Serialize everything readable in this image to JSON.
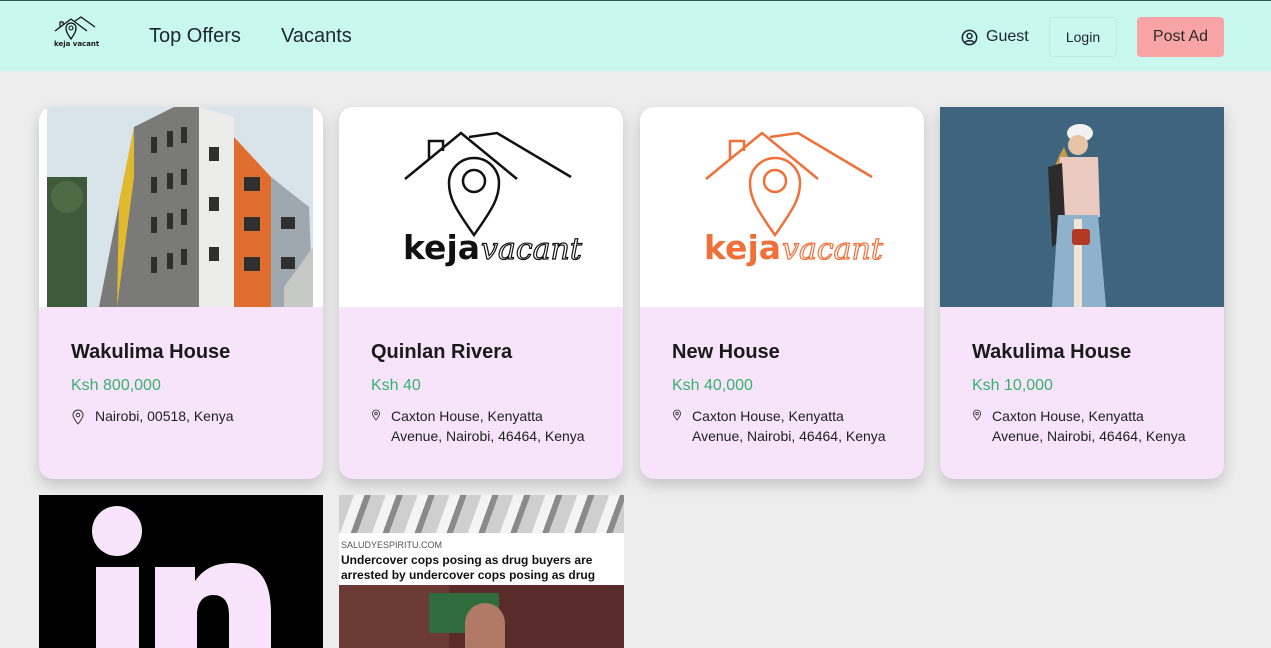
{
  "nav": {
    "logo_text": "keja vacant",
    "links": [
      "Top Offers",
      "Vacants"
    ],
    "guest_label": "Guest",
    "login_label": "Login",
    "post_ad_label": "Post Ad"
  },
  "listings": [
    {
      "title": "Wakulima House",
      "price": "Ksh 800,000",
      "location": "Nairobi, 00518, Kenya",
      "image": "building-photo"
    },
    {
      "title": "Quinlan Rivera",
      "price": "Ksh 40",
      "location": "Caxton House, Kenyatta Avenue, Nairobi, 46464, Kenya",
      "image": "keja-vacant-logo-black"
    },
    {
      "title": "New House",
      "price": "Ksh 40,000",
      "location": "Caxton House, Kenyatta Avenue, Nairobi, 46464, Kenya",
      "image": "keja-vacant-logo-orange"
    },
    {
      "title": "Wakulima House",
      "price": "Ksh 10,000",
      "location": "Caxton House, Kenyatta Avenue, Nairobi, 46464, Kenya",
      "image": "fashion-photo"
    }
  ],
  "partial_cards": [
    {
      "image": "linkedin-logo",
      "logo_text": "in"
    },
    {
      "image": "news-meme",
      "source": "SALUDYESPIRITU.COM",
      "headline": "Undercover cops posing as drug buyers are arrested by undercover cops posing as drug dealers."
    }
  ],
  "logo_words": {
    "keja": "keja",
    "vacant": "vacant"
  },
  "colors": {
    "nav_bg": "#c9f8ee",
    "card_bg": "#f7e4fb",
    "price": "#35b36a",
    "post_ad": "#f9a4a4",
    "brand_orange": "#f0703a"
  }
}
